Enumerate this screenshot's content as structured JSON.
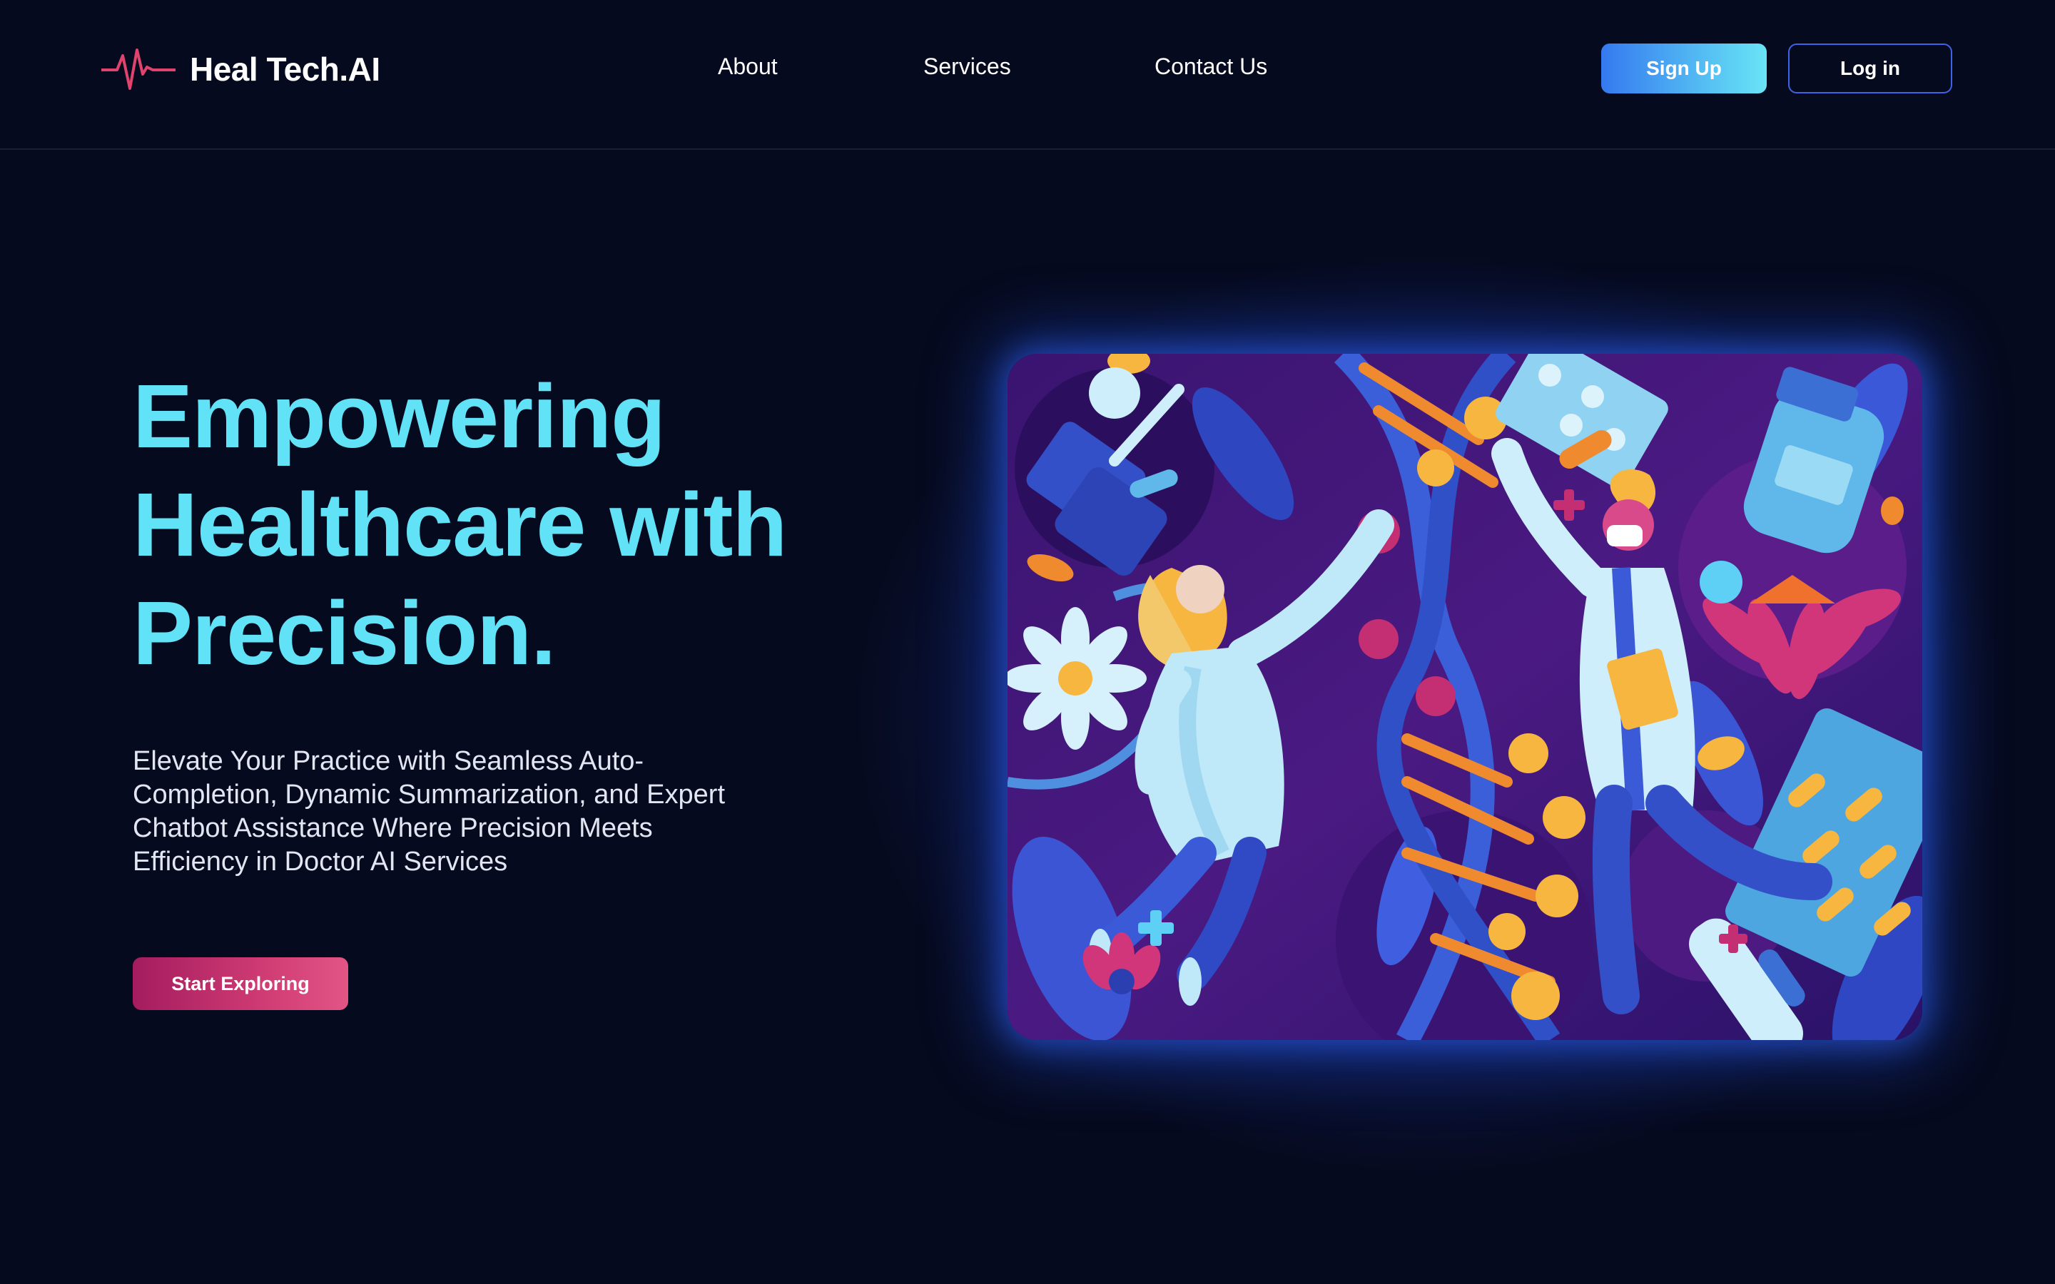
{
  "header": {
    "logo_text": "Heal Tech.AI",
    "logo_icon": "heartbeat-pulse-icon",
    "nav": {
      "about": "About",
      "services": "Services",
      "contact": "Contact Us"
    },
    "signup_label": "Sign Up",
    "login_label": "Log in"
  },
  "hero": {
    "title_lines": [
      "Empowering",
      "Healthcare with",
      "Precision."
    ],
    "subtitle": "Elevate Your Practice with Seamless Auto-Completion, Dynamic Summarization, and Expert Chatbot Assistance Where Precision Meets Efficiency in Doctor AI Services",
    "cta_label": "Start Exploring",
    "illustration": "medical-doctors-dna-illustration"
  },
  "colors": {
    "background": "#060a1e",
    "title": "#62e2f6",
    "accent_pink": "#cf3b73",
    "accent_blue": "#3579f0",
    "logo_pulse": "#e0436e"
  }
}
